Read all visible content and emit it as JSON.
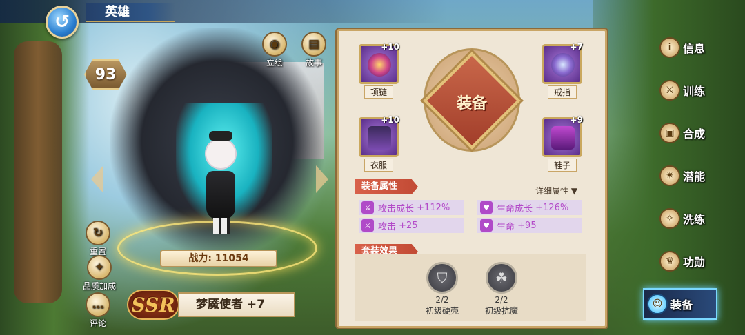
{
  "header": {
    "title": "英雄",
    "back_icon": "↺"
  },
  "hero": {
    "level": "93",
    "power": "战力: 11054",
    "rarity": "SSR",
    "name": "梦魇使者 +7"
  },
  "hero_actions": [
    {
      "label": "立绘",
      "icon": "eye-icon",
      "glyph": "◉"
    },
    {
      "label": "故事",
      "icon": "book-icon",
      "glyph": "▤"
    },
    {
      "label": "重置",
      "icon": "reset-icon",
      "glyph": "↻"
    },
    {
      "label": "品质加成",
      "icon": "quality-icon",
      "glyph": "✦"
    },
    {
      "label": "评论",
      "icon": "comment-icon",
      "glyph": "…"
    }
  ],
  "equipment": {
    "title": "装备",
    "slots": [
      {
        "label": "项链",
        "level": "+10"
      },
      {
        "label": "戒指",
        "level": "+7"
      },
      {
        "label": "衣服",
        "level": "+10"
      },
      {
        "label": "鞋子",
        "level": "+9"
      }
    ]
  },
  "attributes": {
    "title": "装备属性",
    "detail_link": "详细属性",
    "stats": [
      {
        "label": "攻击成长",
        "value": "+112%",
        "icon": "sword-icon"
      },
      {
        "label": "生命成长",
        "value": "+126%",
        "icon": "heart-icon"
      },
      {
        "label": "攻击",
        "value": "+25",
        "icon": "sword-icon"
      },
      {
        "label": "生命",
        "value": "+95",
        "icon": "heart-icon"
      }
    ]
  },
  "set_effects": {
    "title": "套装效果",
    "items": [
      {
        "count": "2/2",
        "name": "初级硬壳"
      },
      {
        "count": "2/2",
        "name": "初级抗魔"
      }
    ]
  },
  "tabs": [
    {
      "label": "信息",
      "icon": "info-icon",
      "glyph": "i"
    },
    {
      "label": "训练",
      "icon": "training-icon",
      "glyph": "⚔"
    },
    {
      "label": "合成",
      "icon": "synthesis-icon",
      "glyph": "▣"
    },
    {
      "label": "潜能",
      "icon": "potential-icon",
      "glyph": "✷"
    },
    {
      "label": "洗练",
      "icon": "refine-icon",
      "glyph": "✧"
    },
    {
      "label": "功勋",
      "icon": "merit-icon",
      "glyph": "♛"
    },
    {
      "label": "装备",
      "icon": "equipment-icon",
      "glyph": "☺"
    }
  ],
  "active_tab": "装备",
  "colors": {
    "accent": "#c24a34",
    "stat_text": "#b34ac8",
    "panel_bg": "#efe6d6",
    "active_tab_glow": "#6ad0ff"
  }
}
